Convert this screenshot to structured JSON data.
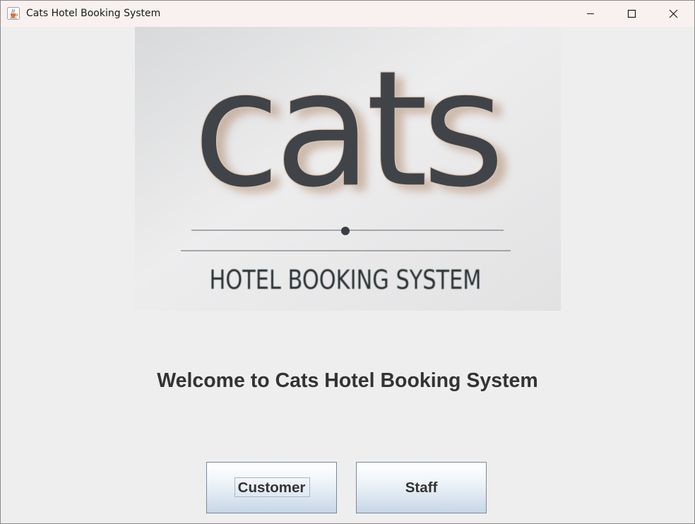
{
  "window": {
    "title": "Cats Hotel Booking System",
    "app_icon": "java-cup-icon",
    "controls": [
      "minimize-icon",
      "maximize-icon",
      "close-icon"
    ]
  },
  "logo": {
    "wordmark": "cats",
    "subtitle": "HOTEL BOOKING SYSTEM"
  },
  "main": {
    "welcome_text": "Welcome to Cats Hotel Booking System"
  },
  "buttons": {
    "customer_label": "Customer",
    "staff_label": "Staff"
  },
  "colors": {
    "window_background": "#eeeeee",
    "titlebar_background": "#f9f1ef",
    "button_gradient_bottom": "#c6d6e6",
    "text": "#333333",
    "logo_letters": "#404448"
  }
}
